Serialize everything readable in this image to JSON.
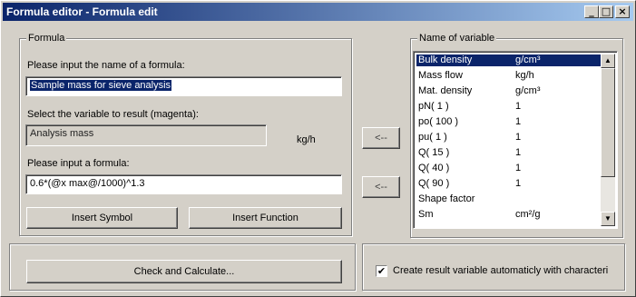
{
  "window": {
    "title": "Formula editor - Formula edit",
    "minimize_label": "_",
    "maximize_label": "□",
    "close_label": "×"
  },
  "formula_group": {
    "legend": "Formula",
    "name_prompt": "Please input the name of a formula:",
    "name_value": "Sample mass for sieve analysis",
    "result_prompt": "Select the variable to result (magenta):",
    "result_value": "Analysis mass",
    "result_unit": "kg/h",
    "formula_prompt": "Please input a formula:",
    "formula_value": "0.6*(@x max@/1000)^1.3",
    "insert_symbol_label": "Insert Symbol",
    "insert_function_label": "Insert Function"
  },
  "arrows": {
    "result_arrow_label": "<--",
    "formula_arrow_label": "<--"
  },
  "variables_group": {
    "legend": "Name of variable",
    "items": [
      {
        "name": "Bulk density",
        "unit": "g/cm³",
        "selected": true
      },
      {
        "name": "Mass flow",
        "unit": "kg/h"
      },
      {
        "name": "Mat. density",
        "unit": "g/cm³"
      },
      {
        "name": "pN( 1 )",
        "unit": "1"
      },
      {
        "name": "po( 100 )",
        "unit": "1"
      },
      {
        "name": "pu( 1 )",
        "unit": "1"
      },
      {
        "name": "Q( 15 )",
        "unit": "1"
      },
      {
        "name": "Q( 40 )",
        "unit": "1"
      },
      {
        "name": "Q( 90 )",
        "unit": "1"
      },
      {
        "name": "Shape factor",
        "unit": ""
      },
      {
        "name": "Sm",
        "unit": "cm²/g"
      }
    ],
    "scroll_up_glyph": "▲",
    "scroll_down_glyph": "▼"
  },
  "bottom": {
    "check_calculate_label": "Check and Calculate...",
    "auto_create_label": "Create result variable automaticly with characteri",
    "auto_create_checked": true,
    "check_glyph": "✔"
  }
}
